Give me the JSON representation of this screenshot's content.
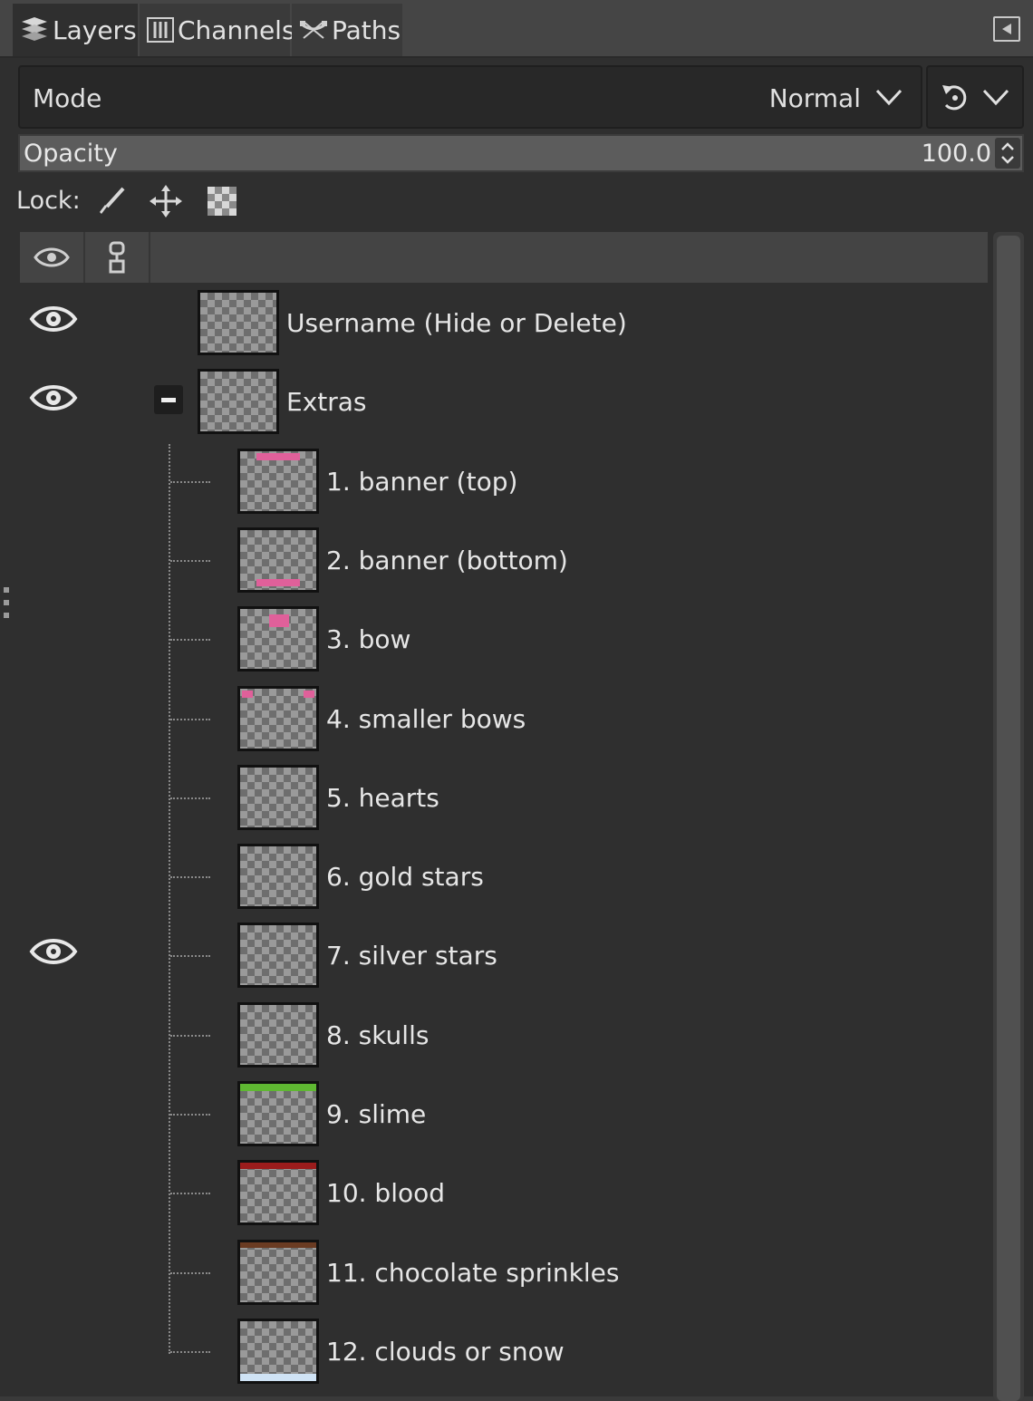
{
  "tabs": [
    {
      "label": "Layers",
      "icon": "layers-icon",
      "active": true
    },
    {
      "label": "Channels",
      "icon": "channels-icon",
      "active": false
    },
    {
      "label": "Paths",
      "icon": "paths-icon",
      "active": false
    }
  ],
  "mode": {
    "label": "Mode",
    "value": "Normal"
  },
  "opacity": {
    "label": "Opacity",
    "value": "100.0"
  },
  "lock": {
    "label": "Lock:"
  },
  "layers": [
    {
      "name": "Username (Hide or Delete)",
      "visible": true,
      "level": 0
    },
    {
      "name": "Extras",
      "visible": true,
      "level": 0,
      "group": true,
      "expanded": true
    },
    {
      "name": "1. banner (top)",
      "visible": false,
      "level": 1
    },
    {
      "name": "2. banner (bottom)",
      "visible": false,
      "level": 1
    },
    {
      "name": "3. bow",
      "visible": false,
      "level": 1
    },
    {
      "name": "4. smaller bows",
      "visible": false,
      "level": 1
    },
    {
      "name": "5. hearts",
      "visible": false,
      "level": 1
    },
    {
      "name": "6. gold stars",
      "visible": false,
      "level": 1
    },
    {
      "name": "7. silver stars",
      "visible": true,
      "level": 1
    },
    {
      "name": "8. skulls",
      "visible": false,
      "level": 1
    },
    {
      "name": "9. slime",
      "visible": false,
      "level": 1
    },
    {
      "name": "10. blood",
      "visible": false,
      "level": 1
    },
    {
      "name": "11. chocolate sprinkles",
      "visible": false,
      "level": 1
    },
    {
      "name": "12. clouds or snow",
      "visible": false,
      "level": 1
    }
  ],
  "colors": {
    "panel_bg": "#2f2f2f",
    "text": "#e6e6e6",
    "banner_pink": "#e0609a",
    "slime_green": "#5fb832",
    "blood_red": "#9b1c1c",
    "chocolate": "#6a3b22",
    "snow": "#cfe3f5"
  }
}
